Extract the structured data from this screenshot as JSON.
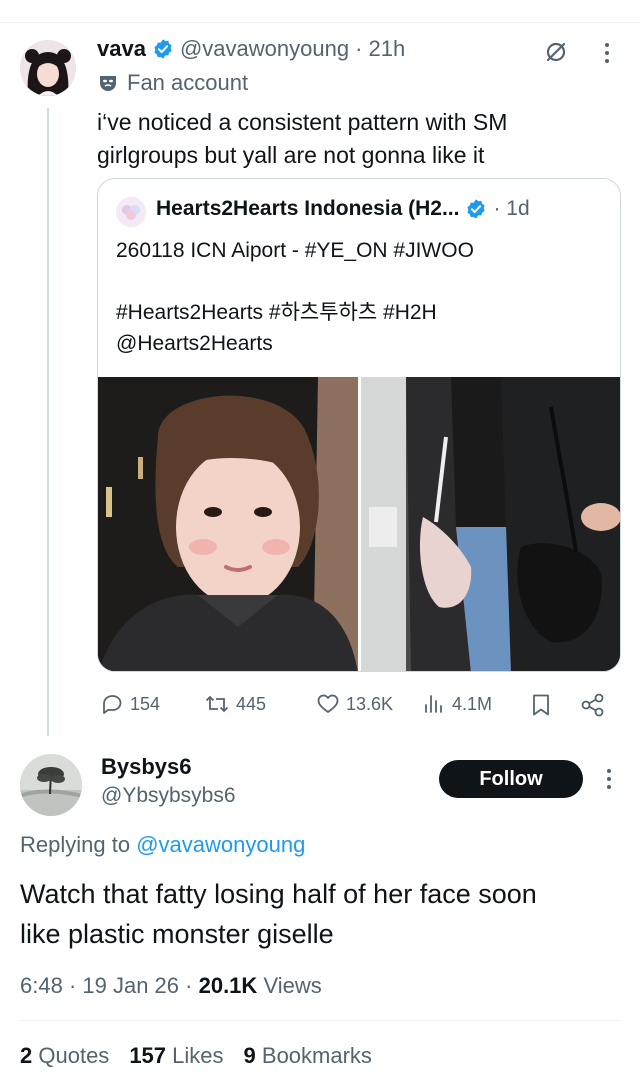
{
  "tweet": {
    "display_name": "vava",
    "handle": "@vavawonyoung",
    "time": "· 21h",
    "label": "Fan account",
    "text_line1": "i‘ve noticed a consistent pattern with SM",
    "text_line2": "girlgroups but yall are not gonna like it"
  },
  "quoted": {
    "display_name": "Hearts2Hearts Indonesia (H2...",
    "time": "· 1d",
    "line1": "260118 ICN Aiport - #YE_ON #JIWOO",
    "line2": "#Hearts2Hearts #하츠투하츠 #H2H",
    "line3": "@Hearts2Hearts"
  },
  "actions": {
    "replies": "154",
    "retweets": "445",
    "likes": "13.6K",
    "views": "4.1M"
  },
  "reply": {
    "display_name": "Bysbys6",
    "handle": "@Ybsybsybs6",
    "follow_label": "Follow",
    "replying_prefix": "Replying to",
    "replying_to": "@vavawonyoung",
    "text_line1": "Watch that fatty losing half of her face soon",
    "text_line2": "like plastic monster giselle",
    "time": "6:48",
    "date": "· 19 Jan 26 ·",
    "views_count": "20.1K",
    "views_label": "Views"
  },
  "stats": {
    "quotes_count": "2",
    "quotes_label": "Quotes",
    "likes_count": "157",
    "likes_label": "Likes",
    "bookmarks_count": "9",
    "bookmarks_label": "Bookmarks"
  },
  "colors": {
    "accent": "#1d9bf0",
    "text": "#0f1419",
    "muted": "#536471"
  },
  "icons": [
    "verified-icon",
    "mask-icon",
    "grok-icon",
    "more-icon",
    "reply-icon",
    "retweet-icon",
    "like-icon",
    "views-icon",
    "bookmark-icon",
    "share-icon"
  ]
}
